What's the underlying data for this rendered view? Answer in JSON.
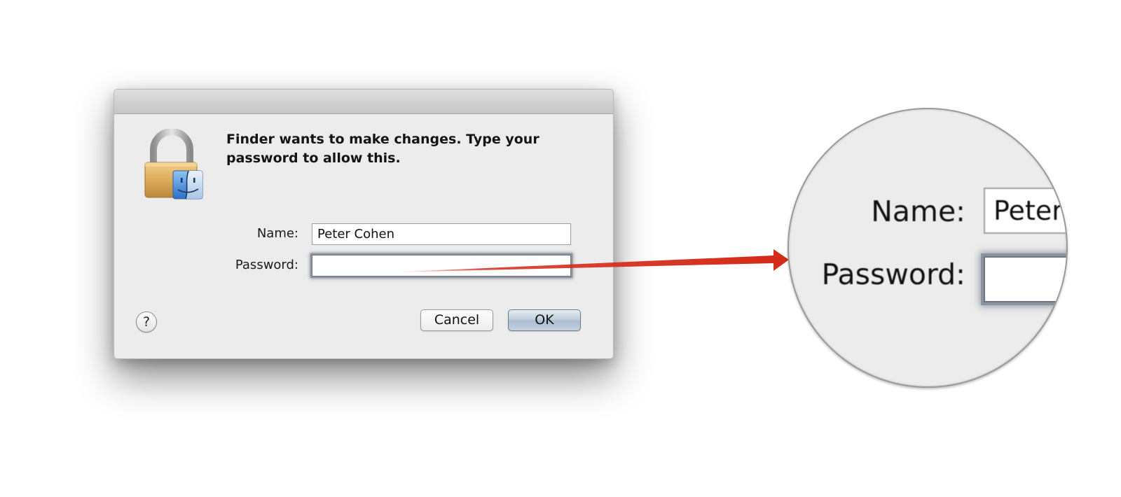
{
  "dialog": {
    "message": "Finder wants to make changes. Type your password to allow this.",
    "name_label": "Name:",
    "name_value": "Peter Cohen",
    "password_label": "Password:",
    "password_value": "",
    "help_label": "?",
    "cancel_label": "Cancel",
    "ok_label": "OK",
    "icon": "lock-finder-icon"
  },
  "magnifier": {
    "name_label": "Name:",
    "name_value": "Peter",
    "password_label": "Password:"
  },
  "colors": {
    "arrow": "#d42a18",
    "dialog_background": "#ececec",
    "ok_button": "#bccad9"
  }
}
